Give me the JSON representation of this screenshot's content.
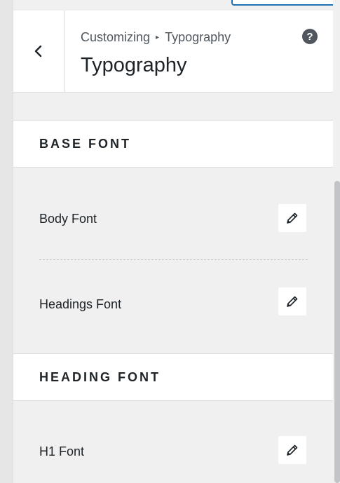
{
  "header": {
    "breadcrumb_parent": "Customizing",
    "breadcrumb_separator": "▸",
    "breadcrumb_current": "Typography",
    "title": "Typography",
    "help_symbol": "?"
  },
  "sections": [
    {
      "title": "BASE FONT",
      "controls": [
        {
          "label": "Body Font",
          "icon": "pencil-icon"
        },
        {
          "label": "Headings Font",
          "icon": "pencil-icon"
        }
      ]
    },
    {
      "title": "HEADING FONT",
      "controls": [
        {
          "label": "H1 Font",
          "icon": "pencil-icon"
        }
      ]
    }
  ],
  "colors": {
    "accent": "#2271b1",
    "panel_bg": "#f0f0f1",
    "card_bg": "#ffffff",
    "text": "#1d2327"
  }
}
